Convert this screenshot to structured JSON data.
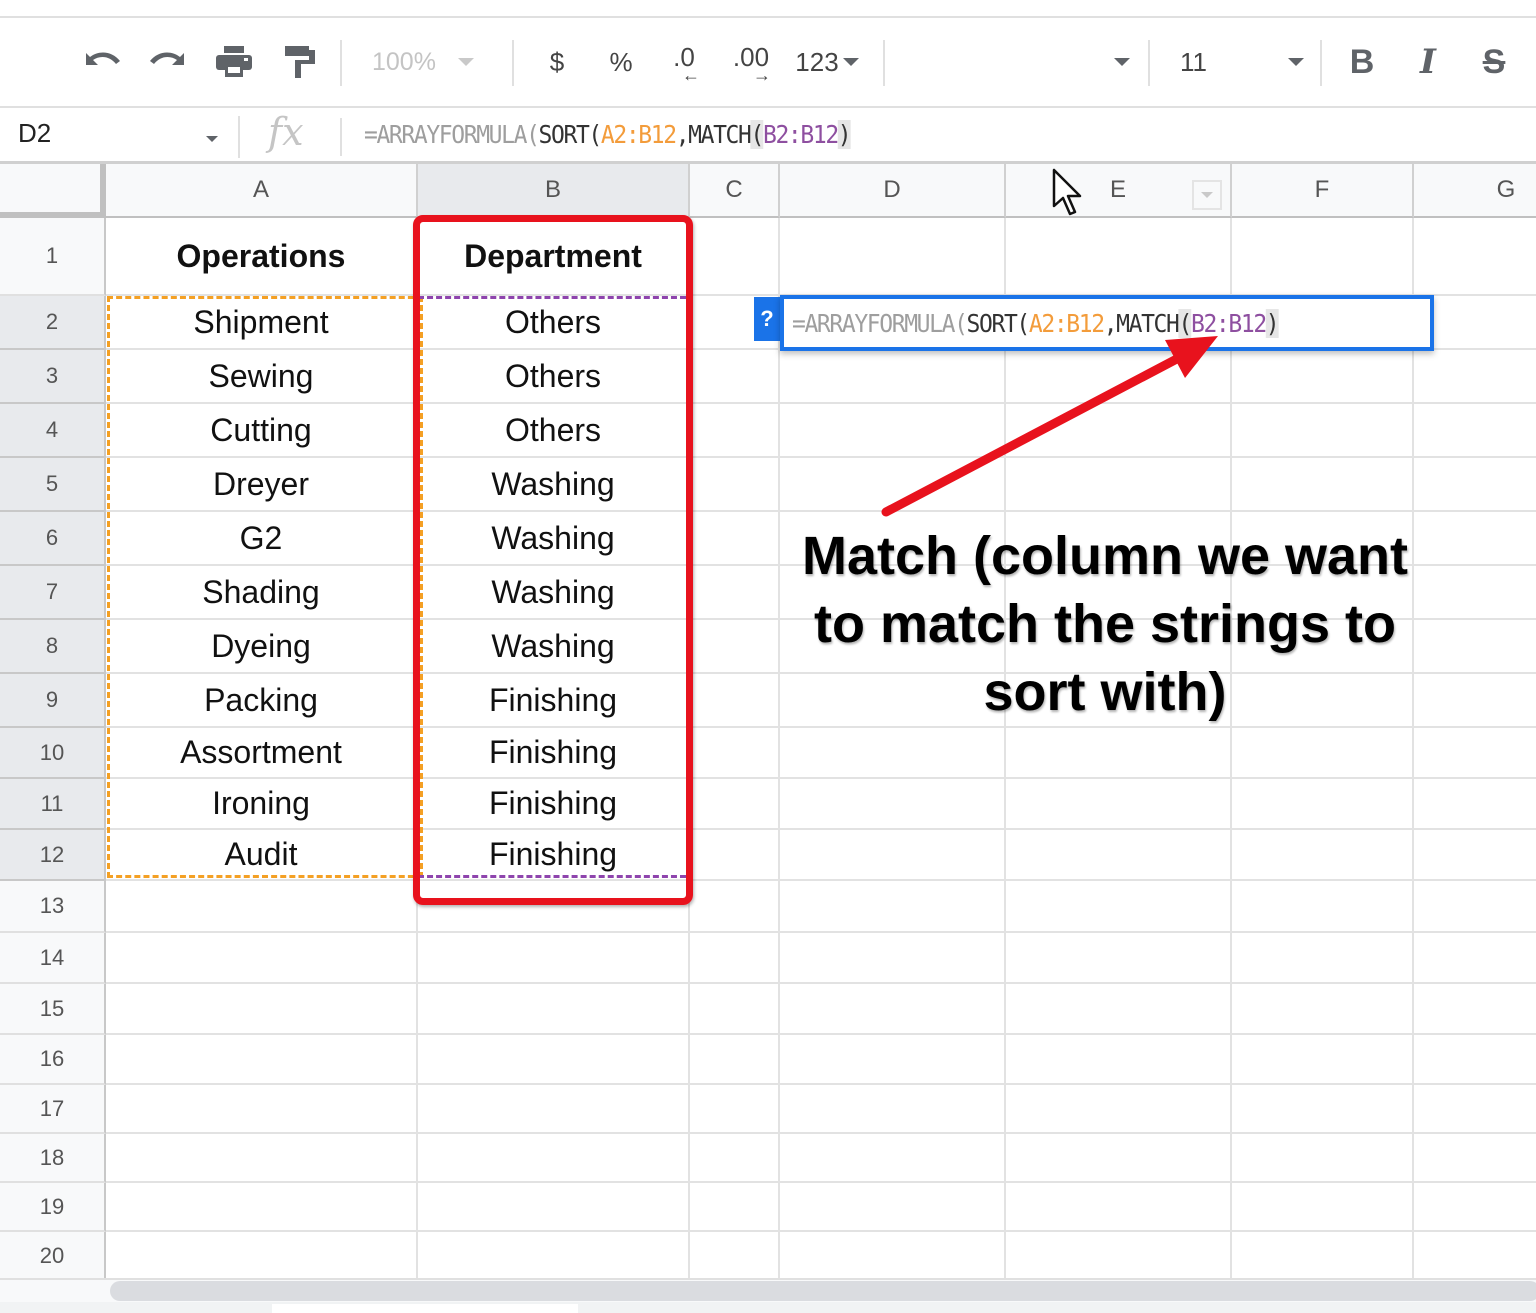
{
  "toolbar": {
    "undo_icon": "undo-icon",
    "redo_icon": "redo-icon",
    "print_icon": "print-icon",
    "paint_format_icon": "paint-format-icon",
    "zoom": "100%",
    "currency": "$",
    "percent": "%",
    "decrease_decimal": ".0",
    "increase_decimal": ".00",
    "more_formats": "123",
    "font_name": "",
    "font_size": "11",
    "bold": "B",
    "italic": "I",
    "strikethrough": "S"
  },
  "formula_bar": {
    "name_box": "D2",
    "fx_label": "fx",
    "formula_parts": [
      {
        "text": "=ARRAYFORMULA(",
        "style": "gray"
      },
      {
        "text": "SORT(",
        "style": "dark"
      },
      {
        "text": "A2:B12",
        "style": "orange"
      },
      {
        "text": ",MATCH",
        "style": "dark"
      },
      {
        "text": "(",
        "style": "hl"
      },
      {
        "text": "B2:B12",
        "style": "purple"
      },
      {
        "text": ")",
        "style": "hl"
      }
    ]
  },
  "columns": [
    "A",
    "B",
    "C",
    "D",
    "E",
    "F",
    "G"
  ],
  "rows": [
    "1",
    "2",
    "3",
    "4",
    "5",
    "6",
    "7",
    "8",
    "9",
    "10",
    "11",
    "12",
    "13",
    "14",
    "15",
    "16",
    "17",
    "18",
    "19",
    "20"
  ],
  "table": {
    "headers": [
      "Operations",
      "Department"
    ],
    "rows": [
      [
        "Shipment",
        "Others"
      ],
      [
        "Sewing",
        "Others"
      ],
      [
        "Cutting",
        "Others"
      ],
      [
        "Dreyer",
        "Washing"
      ],
      [
        "G2",
        "Washing"
      ],
      [
        "Shading",
        "Washing"
      ],
      [
        "Dyeing",
        "Washing"
      ],
      [
        "Packing",
        "Finishing"
      ],
      [
        "Assortment",
        "Finishing"
      ],
      [
        "Ironing",
        "Finishing"
      ],
      [
        "Audit",
        "Finishing"
      ]
    ]
  },
  "cell_editor": {
    "help_badge": "?",
    "formula": "=ARRAYFORMULA(SORT(A2:B12,MATCH(B2:B12)"
  },
  "annotation": {
    "text": "Match (column we want to match the strings to sort with)"
  },
  "colors": {
    "highlight_red": "#e8121d",
    "range_orange": "#f4a024",
    "range_purple": "#8e44ad",
    "selection_blue": "#1a73e8"
  }
}
